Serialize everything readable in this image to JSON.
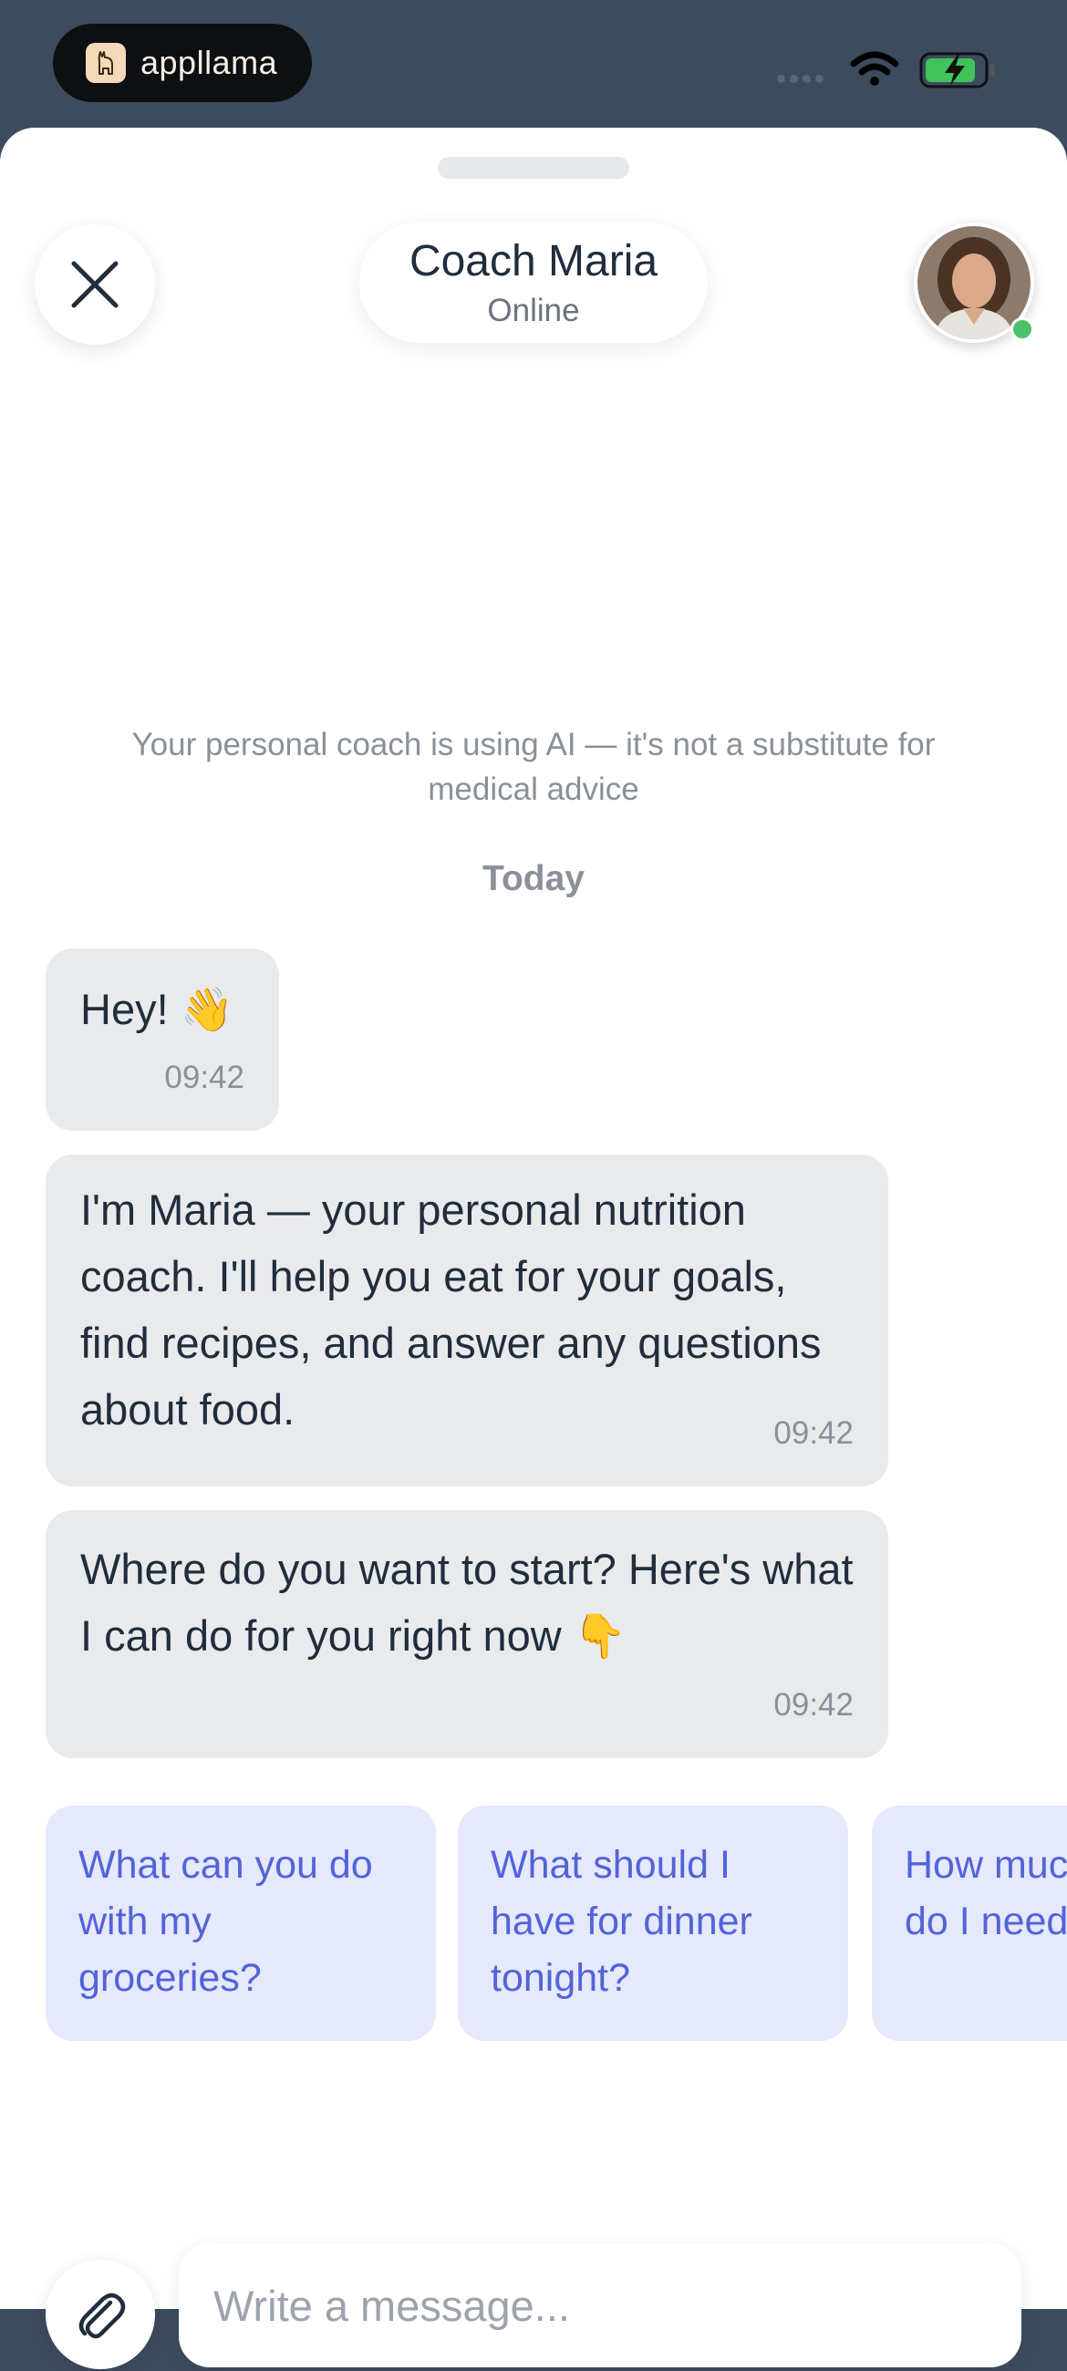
{
  "status_bar": {
    "brand_name": "appllama",
    "icons": [
      "llama-logo-icon",
      "cellular-signal-icon",
      "wifi-icon",
      "battery-charging-icon"
    ],
    "battery_color": "#3ec45a"
  },
  "header": {
    "close_icon": "close-icon",
    "coach_name": "Coach Maria",
    "coach_status": "Online",
    "avatar_icon": "coach-avatar",
    "online_color": "#4cc36a"
  },
  "chat": {
    "disclaimer": "Your personal coach is using AI — it's not a substitute for medical advice",
    "day_label": "Today",
    "messages": [
      {
        "text": "Hey! 👋",
        "time": "09:42"
      },
      {
        "text": "I'm Maria — your personal nutrition coach. I'll help you eat for your goals, find recipes, and answer any questions about food.",
        "time": "09:42"
      },
      {
        "text": "Where do you want to start? Here's what I can do for you right now  👇",
        "time": "09:42"
      }
    ],
    "suggestions": [
      "What can you do with my groceries?",
      "What should I have for dinner tonight?",
      "How much water do I need"
    ],
    "accent_color": "#5363d8"
  },
  "composer": {
    "attach_icon": "paperclip-icon",
    "placeholder": "Write a message..."
  }
}
